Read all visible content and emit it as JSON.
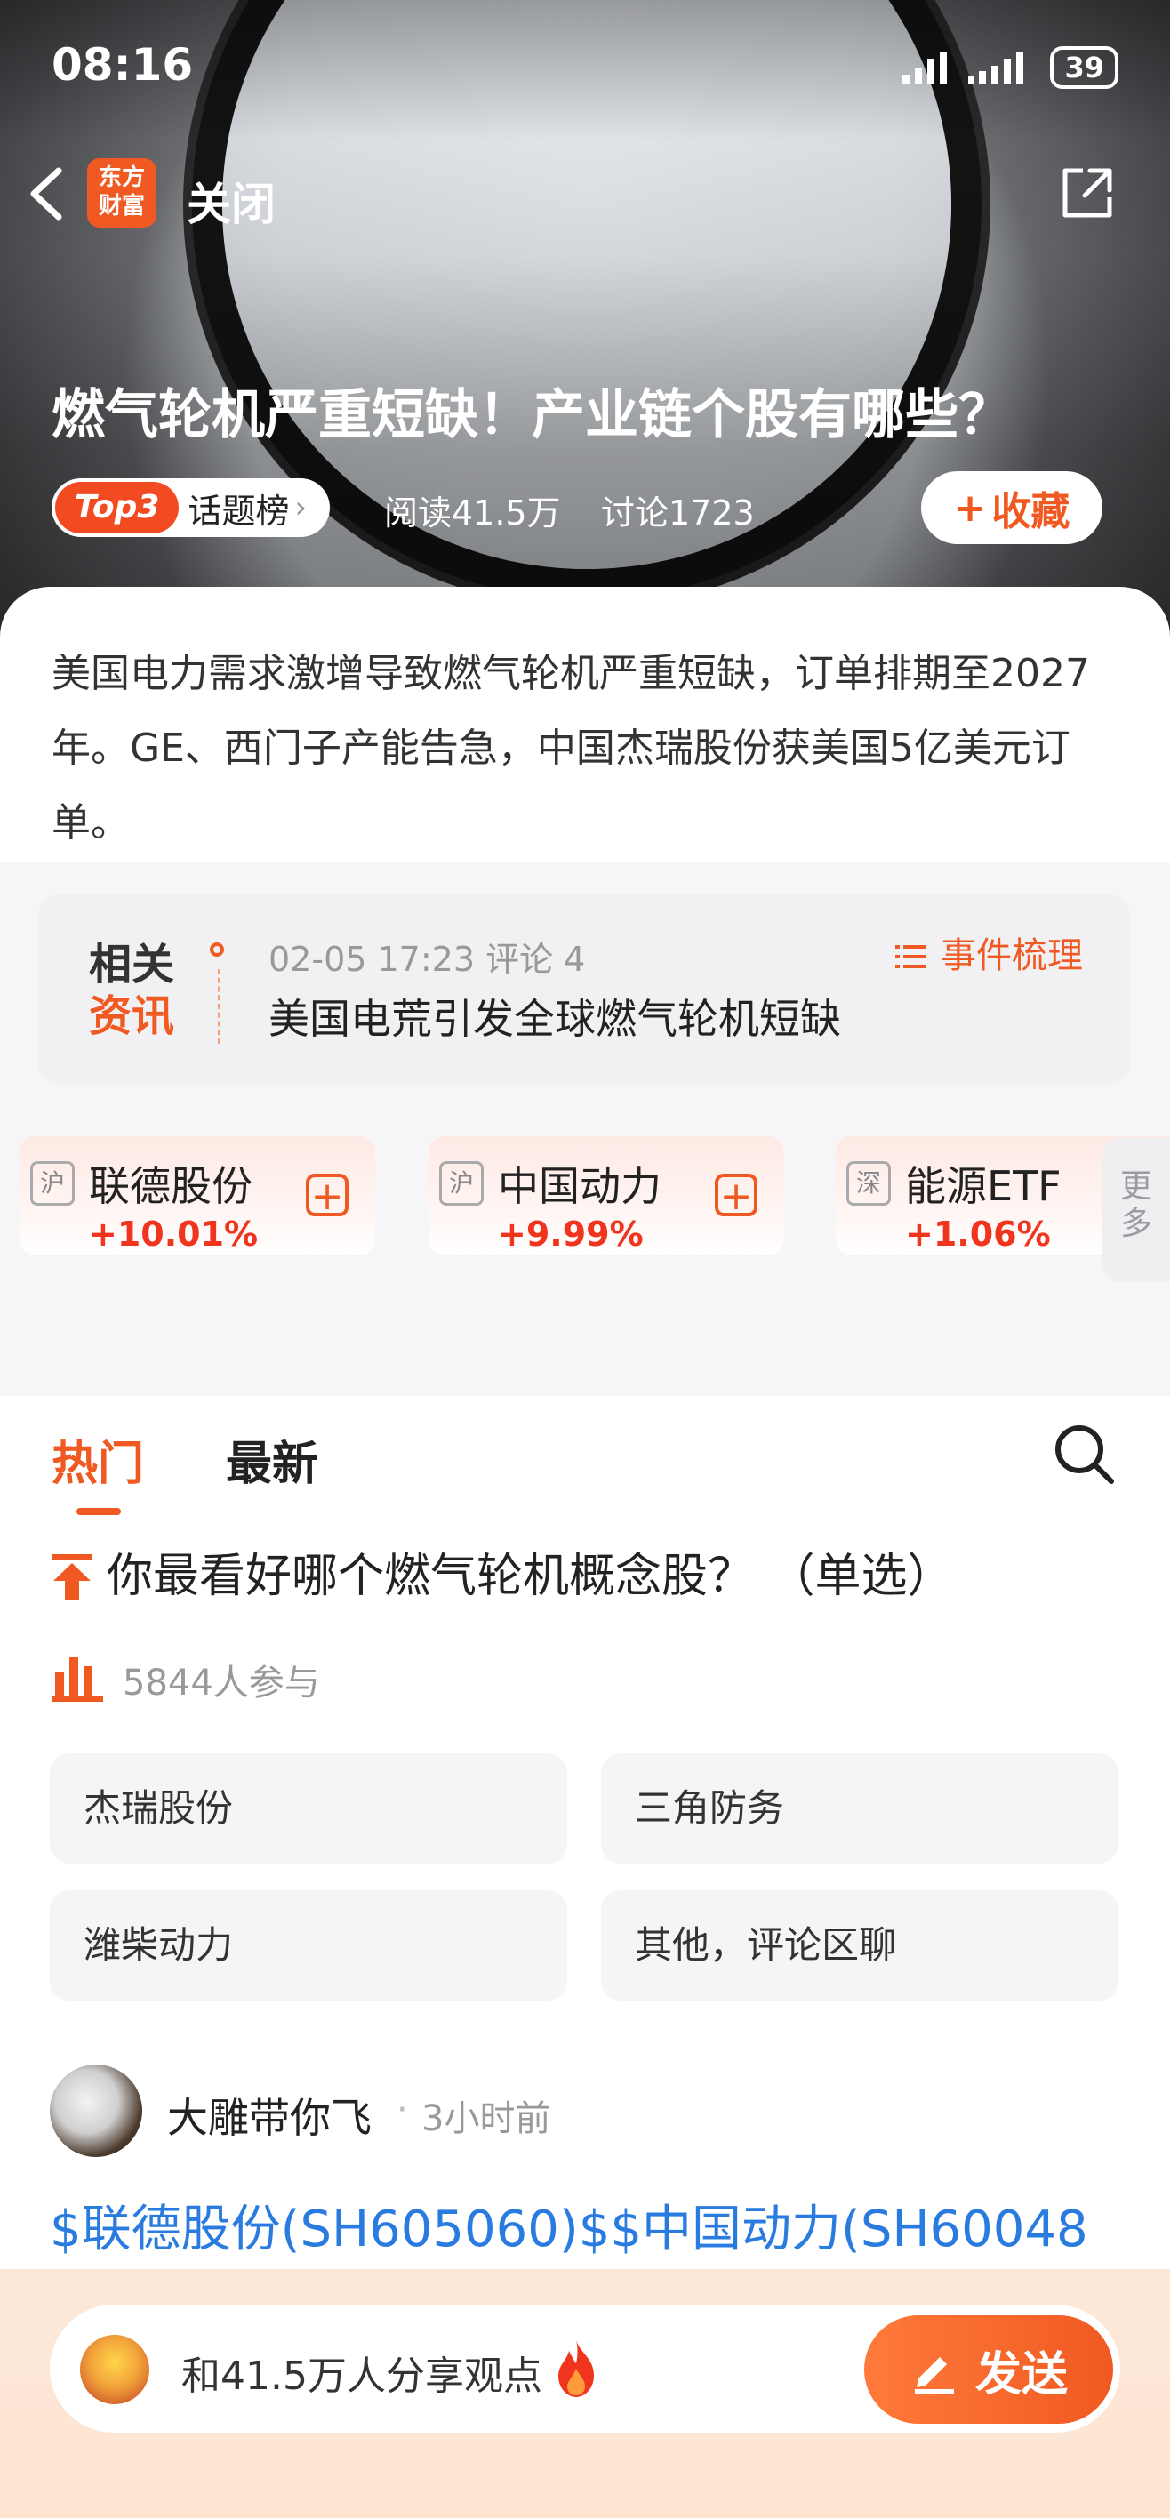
{
  "status_bar": {
    "time": "08:16",
    "battery": "39"
  },
  "topbar": {
    "logo_line1": "东方",
    "logo_line2": "财富",
    "close_label": "关闭"
  },
  "topic": {
    "title": "燃气轮机严重短缺！产业链个股有哪些？",
    "badge": "Top3",
    "badge_label": "话题榜",
    "reads": "阅读41.5万",
    "discussions": "讨论1723",
    "favorite_label": "收藏",
    "summary": "美国电力需求激增导致燃气轮机严重短缺，订单排期至2027年。GE、西门子产能告急，中国杰瑞股份获美国5亿美元订单。"
  },
  "news": {
    "tag_line1": "相关",
    "tag_line2": "资讯",
    "meta": "02-05 17:23 评论 4",
    "headline": "美国电荒引发全球燃气轮机短缺",
    "action": "事件梳理"
  },
  "stocks": [
    {
      "market": "沪",
      "name": "联德股份",
      "change": "+10.01%"
    },
    {
      "market": "沪",
      "name": "中国动力",
      "change": "+9.99%"
    },
    {
      "market": "深",
      "name": "能源ETF",
      "change": "+1.06%"
    }
  ],
  "more_label_1": "更",
  "more_label_2": "多",
  "tabs": {
    "hot": "热门",
    "latest": "最新"
  },
  "poll": {
    "title": "你最看好哪个燃气轮机概念股？ （单选）",
    "participants": "5844人参与",
    "options": [
      "杰瑞股份",
      "三角防务",
      "潍柴动力",
      "其他，评论区聊"
    ]
  },
  "post": {
    "author": "大雕带你飞",
    "separator": "·",
    "time": "3小时前",
    "text": "$联德股份(SH605060)$$中国动力(SH60048"
  },
  "composer": {
    "placeholder": "和41.5万人分享观点",
    "send_label": "发送"
  },
  "colors": {
    "accent": "#f05a22",
    "rise": "#f0341e",
    "link": "#2a7be0"
  }
}
